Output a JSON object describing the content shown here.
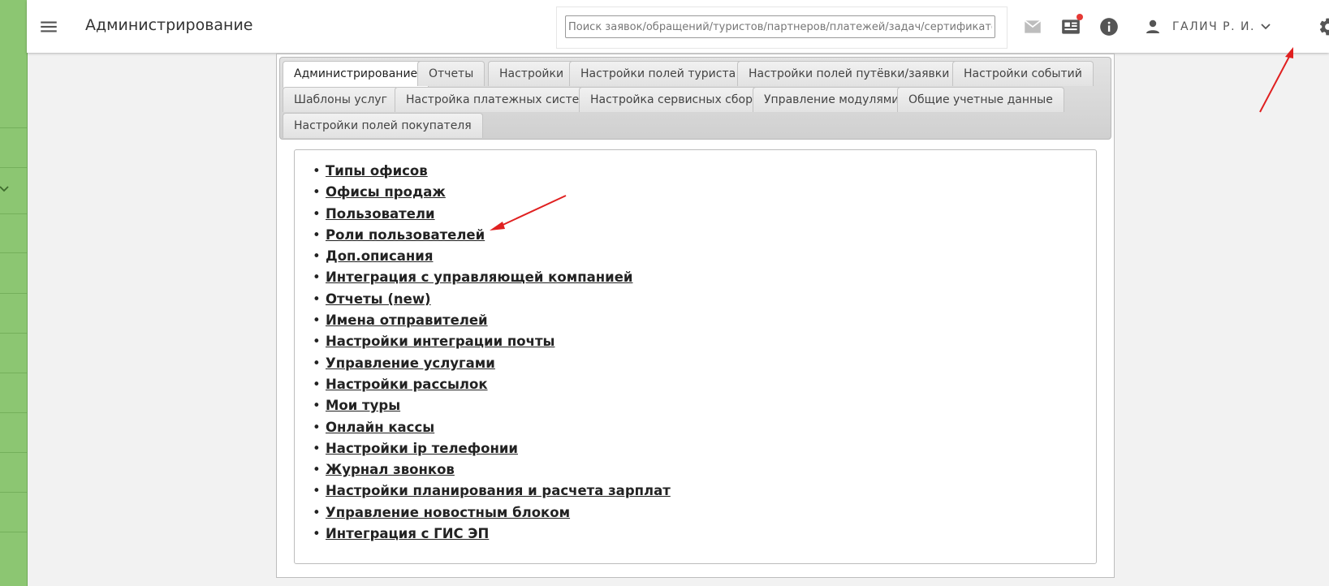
{
  "topbar": {
    "menu_icon": "menu-icon",
    "title": "Администрирование",
    "search_placeholder": "Поиск заявок/обращений/туристов/партнеров/платежей/задач/сертификатов",
    "icons": [
      "mail-icon",
      "news-icon",
      "info-icon",
      "gear-icon"
    ],
    "user_name": "ГАЛИЧ Р. И."
  },
  "tabs": [
    "Администрирование",
    "Отчеты",
    "Настройки",
    "Настройки полей туриста",
    "Настройки полей путёвки/заявки",
    "Настройки событий",
    "Шаблоны услуг",
    "Настройка платежных систем",
    "Настройка сервисных сборов",
    "Управление модулями",
    "Общие учетные данные",
    "Настройки полей покупателя"
  ],
  "active_tab": "Администрирование",
  "links": [
    "Типы офисов",
    "Офисы продаж",
    "Пользователи",
    "Роли пользователей",
    "Доп.описания",
    "Интеграция с управляющей компанией",
    "Отчеты (new)",
    "Имена отправителей",
    "Настройки интеграции почты",
    "Управление услугами",
    "Настройки рассылок",
    "Мои туры",
    "Онлайн кассы",
    "Настройки ip телефонии",
    "Журнал звонков",
    "Настройки планирования и расчета зарплат",
    "Управление новостным блоком",
    "Интеграция с ГИС ЭП"
  ],
  "colors": {
    "sidebar_green": "#8cc672",
    "annotation_arrow": "#e02020",
    "notification_dot": "#e53935"
  }
}
